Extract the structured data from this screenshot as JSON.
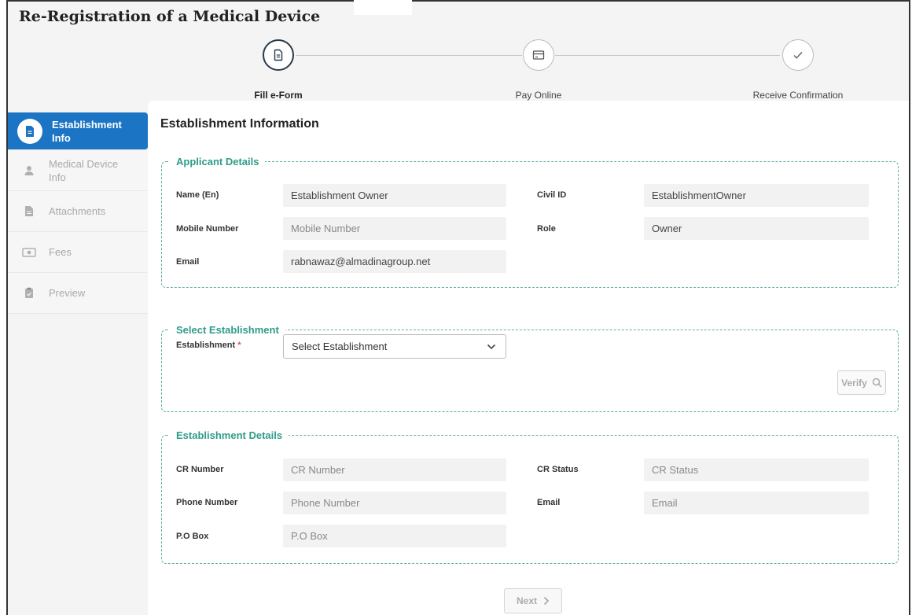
{
  "page": {
    "title": "Re-Registration of a Medical Device"
  },
  "stepper": {
    "steps": [
      {
        "label": "Fill e-Form",
        "icon": "document-icon",
        "active": true
      },
      {
        "label": "Pay Online",
        "icon": "card-icon",
        "active": false
      },
      {
        "label": "Receive Confirmation",
        "icon": "check-icon",
        "active": false
      }
    ]
  },
  "sidebar": {
    "items": [
      {
        "label": "Establishment Info",
        "icon": "document-icon",
        "active": true
      },
      {
        "label": "Medical Device Info",
        "icon": "user-icon",
        "active": false
      },
      {
        "label": "Attachments",
        "icon": "file-icon",
        "active": false
      },
      {
        "label": "Fees",
        "icon": "money-icon",
        "active": false
      },
      {
        "label": "Preview",
        "icon": "clipboard-icon",
        "active": false
      }
    ]
  },
  "main": {
    "title": "Establishment Information"
  },
  "applicant": {
    "legend": "Applicant Details",
    "name_label": "Name (En)",
    "name_value": "Establishment Owner",
    "civil_label": "Civil ID",
    "civil_value": "EstablishmentOwner",
    "mobile_label": "Mobile Number",
    "mobile_placeholder": "Mobile Number",
    "role_label": "Role",
    "role_value": "Owner",
    "email_label": "Email",
    "email_value": "rabnawaz@almadinagroup.net"
  },
  "select_establishment": {
    "legend": "Select Establishment",
    "label": "Establishment",
    "required_mark": "*",
    "selected": "Select Establishment",
    "verify_label": "Verify"
  },
  "establishment_details": {
    "legend": "Establishment Details",
    "cr_number_label": "CR Number",
    "cr_number_placeholder": "CR Number",
    "cr_status_label": "CR Status",
    "cr_status_placeholder": "CR Status",
    "phone_label": "Phone Number",
    "phone_placeholder": "Phone Number",
    "email_label": "Email",
    "email_placeholder": "Email",
    "pobox_label": "P.O Box",
    "pobox_placeholder": "P.O Box"
  },
  "footer": {
    "next_label": "Next"
  },
  "colors": {
    "accent": "#1c74c4",
    "section": "#2e9c88",
    "border": "#5fb0a8"
  }
}
